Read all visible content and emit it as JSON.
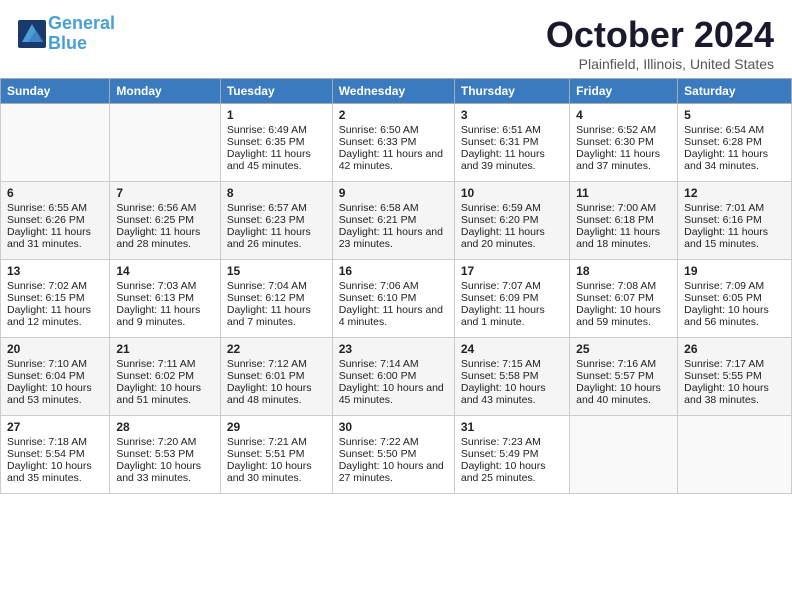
{
  "header": {
    "logo_line1": "General",
    "logo_line2": "Blue",
    "month_title": "October 2024",
    "location": "Plainfield, Illinois, United States"
  },
  "days_of_week": [
    "Sunday",
    "Monday",
    "Tuesday",
    "Wednesday",
    "Thursday",
    "Friday",
    "Saturday"
  ],
  "weeks": [
    [
      {
        "num": "",
        "empty": true
      },
      {
        "num": "",
        "empty": true
      },
      {
        "num": "1",
        "sunrise": "Sunrise: 6:49 AM",
        "sunset": "Sunset: 6:35 PM",
        "daylight": "Daylight: 11 hours and 45 minutes."
      },
      {
        "num": "2",
        "sunrise": "Sunrise: 6:50 AM",
        "sunset": "Sunset: 6:33 PM",
        "daylight": "Daylight: 11 hours and 42 minutes."
      },
      {
        "num": "3",
        "sunrise": "Sunrise: 6:51 AM",
        "sunset": "Sunset: 6:31 PM",
        "daylight": "Daylight: 11 hours and 39 minutes."
      },
      {
        "num": "4",
        "sunrise": "Sunrise: 6:52 AM",
        "sunset": "Sunset: 6:30 PM",
        "daylight": "Daylight: 11 hours and 37 minutes."
      },
      {
        "num": "5",
        "sunrise": "Sunrise: 6:54 AM",
        "sunset": "Sunset: 6:28 PM",
        "daylight": "Daylight: 11 hours and 34 minutes."
      }
    ],
    [
      {
        "num": "6",
        "sunrise": "Sunrise: 6:55 AM",
        "sunset": "Sunset: 6:26 PM",
        "daylight": "Daylight: 11 hours and 31 minutes."
      },
      {
        "num": "7",
        "sunrise": "Sunrise: 6:56 AM",
        "sunset": "Sunset: 6:25 PM",
        "daylight": "Daylight: 11 hours and 28 minutes."
      },
      {
        "num": "8",
        "sunrise": "Sunrise: 6:57 AM",
        "sunset": "Sunset: 6:23 PM",
        "daylight": "Daylight: 11 hours and 26 minutes."
      },
      {
        "num": "9",
        "sunrise": "Sunrise: 6:58 AM",
        "sunset": "Sunset: 6:21 PM",
        "daylight": "Daylight: 11 hours and 23 minutes."
      },
      {
        "num": "10",
        "sunrise": "Sunrise: 6:59 AM",
        "sunset": "Sunset: 6:20 PM",
        "daylight": "Daylight: 11 hours and 20 minutes."
      },
      {
        "num": "11",
        "sunrise": "Sunrise: 7:00 AM",
        "sunset": "Sunset: 6:18 PM",
        "daylight": "Daylight: 11 hours and 18 minutes."
      },
      {
        "num": "12",
        "sunrise": "Sunrise: 7:01 AM",
        "sunset": "Sunset: 6:16 PM",
        "daylight": "Daylight: 11 hours and 15 minutes."
      }
    ],
    [
      {
        "num": "13",
        "sunrise": "Sunrise: 7:02 AM",
        "sunset": "Sunset: 6:15 PM",
        "daylight": "Daylight: 11 hours and 12 minutes."
      },
      {
        "num": "14",
        "sunrise": "Sunrise: 7:03 AM",
        "sunset": "Sunset: 6:13 PM",
        "daylight": "Daylight: 11 hours and 9 minutes."
      },
      {
        "num": "15",
        "sunrise": "Sunrise: 7:04 AM",
        "sunset": "Sunset: 6:12 PM",
        "daylight": "Daylight: 11 hours and 7 minutes."
      },
      {
        "num": "16",
        "sunrise": "Sunrise: 7:06 AM",
        "sunset": "Sunset: 6:10 PM",
        "daylight": "Daylight: 11 hours and 4 minutes."
      },
      {
        "num": "17",
        "sunrise": "Sunrise: 7:07 AM",
        "sunset": "Sunset: 6:09 PM",
        "daylight": "Daylight: 11 hours and 1 minute."
      },
      {
        "num": "18",
        "sunrise": "Sunrise: 7:08 AM",
        "sunset": "Sunset: 6:07 PM",
        "daylight": "Daylight: 10 hours and 59 minutes."
      },
      {
        "num": "19",
        "sunrise": "Sunrise: 7:09 AM",
        "sunset": "Sunset: 6:05 PM",
        "daylight": "Daylight: 10 hours and 56 minutes."
      }
    ],
    [
      {
        "num": "20",
        "sunrise": "Sunrise: 7:10 AM",
        "sunset": "Sunset: 6:04 PM",
        "daylight": "Daylight: 10 hours and 53 minutes."
      },
      {
        "num": "21",
        "sunrise": "Sunrise: 7:11 AM",
        "sunset": "Sunset: 6:02 PM",
        "daylight": "Daylight: 10 hours and 51 minutes."
      },
      {
        "num": "22",
        "sunrise": "Sunrise: 7:12 AM",
        "sunset": "Sunset: 6:01 PM",
        "daylight": "Daylight: 10 hours and 48 minutes."
      },
      {
        "num": "23",
        "sunrise": "Sunrise: 7:14 AM",
        "sunset": "Sunset: 6:00 PM",
        "daylight": "Daylight: 10 hours and 45 minutes."
      },
      {
        "num": "24",
        "sunrise": "Sunrise: 7:15 AM",
        "sunset": "Sunset: 5:58 PM",
        "daylight": "Daylight: 10 hours and 43 minutes."
      },
      {
        "num": "25",
        "sunrise": "Sunrise: 7:16 AM",
        "sunset": "Sunset: 5:57 PM",
        "daylight": "Daylight: 10 hours and 40 minutes."
      },
      {
        "num": "26",
        "sunrise": "Sunrise: 7:17 AM",
        "sunset": "Sunset: 5:55 PM",
        "daylight": "Daylight: 10 hours and 38 minutes."
      }
    ],
    [
      {
        "num": "27",
        "sunrise": "Sunrise: 7:18 AM",
        "sunset": "Sunset: 5:54 PM",
        "daylight": "Daylight: 10 hours and 35 minutes."
      },
      {
        "num": "28",
        "sunrise": "Sunrise: 7:20 AM",
        "sunset": "Sunset: 5:53 PM",
        "daylight": "Daylight: 10 hours and 33 minutes."
      },
      {
        "num": "29",
        "sunrise": "Sunrise: 7:21 AM",
        "sunset": "Sunset: 5:51 PM",
        "daylight": "Daylight: 10 hours and 30 minutes."
      },
      {
        "num": "30",
        "sunrise": "Sunrise: 7:22 AM",
        "sunset": "Sunset: 5:50 PM",
        "daylight": "Daylight: 10 hours and 27 minutes."
      },
      {
        "num": "31",
        "sunrise": "Sunrise: 7:23 AM",
        "sunset": "Sunset: 5:49 PM",
        "daylight": "Daylight: 10 hours and 25 minutes."
      },
      {
        "num": "",
        "empty": true
      },
      {
        "num": "",
        "empty": true
      }
    ]
  ]
}
